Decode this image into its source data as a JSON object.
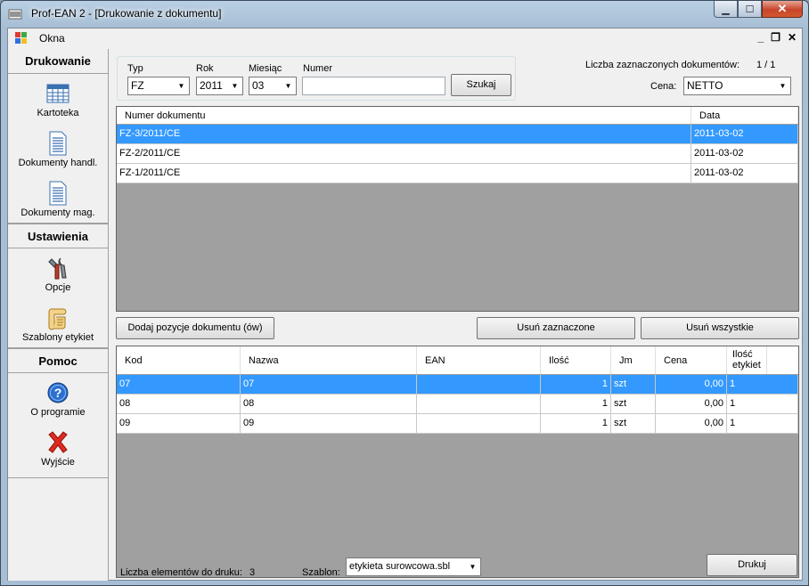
{
  "window": {
    "title": "Prof-EAN  2 - [Drukowanie z dokumentu]"
  },
  "menu": {
    "okna": "Okna"
  },
  "sidebar": {
    "sections": [
      {
        "title": "Drukowanie",
        "items": [
          {
            "label": "Kartoteka",
            "icon": "table-icon"
          },
          {
            "label": "Dokumenty handl.",
            "icon": "document-icon"
          },
          {
            "label": "Dokumenty mag.",
            "icon": "document-icon"
          }
        ]
      },
      {
        "title": "Ustawienia",
        "items": [
          {
            "label": "Opcje",
            "icon": "tools-icon"
          },
          {
            "label": "Szablony etykiet",
            "icon": "scroll-icon"
          }
        ]
      },
      {
        "title": "Pomoc",
        "items": [
          {
            "label": "O programie",
            "icon": "help-icon"
          },
          {
            "label": "Wyjście",
            "icon": "close-x-icon"
          }
        ]
      }
    ]
  },
  "filters": {
    "typ_label": "Typ",
    "typ_value": "FZ",
    "rok_label": "Rok",
    "rok_value": "2011",
    "miesiac_label": "Miesiąc",
    "miesiac_value": "03",
    "numer_label": "Numer",
    "numer_value": "",
    "search_button": "Szukaj"
  },
  "selection": {
    "count_label": "Liczba zaznaczonych dokumentów:",
    "count_value": "1 / 1",
    "cena_label": "Cena:",
    "cena_value": "NETTO"
  },
  "documents": {
    "headers": [
      "Numer dokumentu",
      "Data"
    ],
    "rows": [
      {
        "numer": "FZ-3/2011/CE",
        "data": "2011-03-02",
        "selected": true
      },
      {
        "numer": "FZ-2/2011/CE",
        "data": "2011-03-02",
        "selected": false
      },
      {
        "numer": "FZ-1/2011/CE",
        "data": "2011-03-02",
        "selected": false
      }
    ]
  },
  "actions": {
    "add_positions": "Dodaj pozycje dokumentu (ów)",
    "remove_selected": "Usuń zaznaczone",
    "remove_all": "Usuń wszystkie"
  },
  "positions": {
    "headers": [
      "Kod",
      "Nazwa",
      "EAN",
      "Ilość",
      "Jm",
      "Cena",
      "Ilość etykiet"
    ],
    "rows": [
      {
        "kod": "07",
        "nazwa": "07",
        "ean": "",
        "ilosc": "1",
        "jm": "szt",
        "cena": "0,00",
        "etykiet": "1",
        "selected": true
      },
      {
        "kod": "08",
        "nazwa": "08",
        "ean": "",
        "ilosc": "1",
        "jm": "szt",
        "cena": "0,00",
        "etykiet": "1",
        "selected": false
      },
      {
        "kod": "09",
        "nazwa": "09",
        "ean": "",
        "ilosc": "1",
        "jm": "szt",
        "cena": "0,00",
        "etykiet": "1",
        "selected": false
      }
    ]
  },
  "footer": {
    "elements_label": "Liczba elementów do druku:",
    "elements_value": "3",
    "template_label": "Szablon:",
    "template_value": "etykieta surowcowa.sbl",
    "print_button": "Drukuj"
  },
  "colors": {
    "selection": "#3399ff",
    "grid_empty": "#a0a0a0"
  }
}
